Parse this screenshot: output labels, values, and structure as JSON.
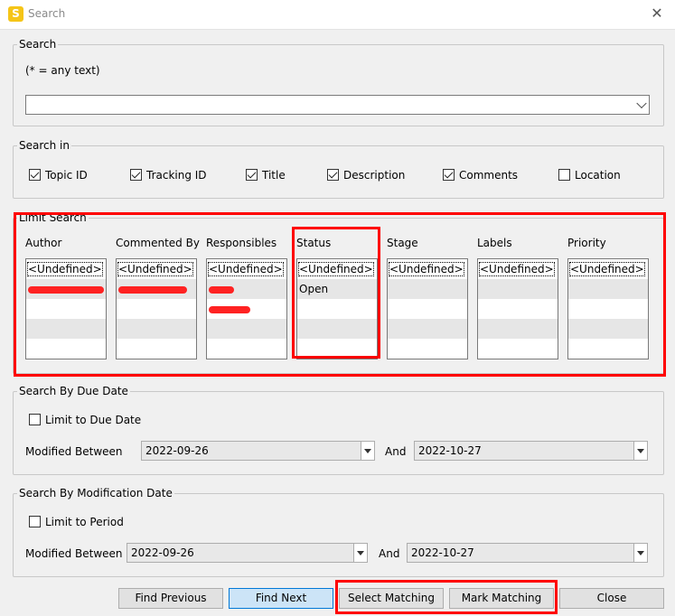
{
  "window": {
    "title": "Search",
    "icon_letter": "S"
  },
  "search": {
    "legend": "Search",
    "hint": "(* = any text)",
    "value": ""
  },
  "search_in": {
    "legend": "Search in",
    "options": [
      {
        "label": "Topic ID",
        "checked": true
      },
      {
        "label": "Tracking ID",
        "checked": true
      },
      {
        "label": "Title",
        "checked": true
      },
      {
        "label": "Description",
        "checked": true
      },
      {
        "label": "Comments",
        "checked": true
      },
      {
        "label": "Location",
        "checked": false
      }
    ]
  },
  "limit_search": {
    "legend": "Limit Search",
    "columns": [
      {
        "label": "Author",
        "items": [
          "<Undefined>"
        ]
      },
      {
        "label": "Commented By",
        "items": [
          "<Undefined>"
        ]
      },
      {
        "label": "Responsibles",
        "items": [
          "<Undefined>"
        ]
      },
      {
        "label": "Status",
        "items": [
          "<Undefined>",
          "Open"
        ]
      },
      {
        "label": "Stage",
        "items": [
          "<Undefined>"
        ]
      },
      {
        "label": "Labels",
        "items": [
          "<Undefined>"
        ]
      },
      {
        "label": "Priority",
        "items": [
          "<Undefined>"
        ]
      }
    ]
  },
  "due_date": {
    "legend": "Search By Due Date",
    "limit_label": "Limit to Due Date",
    "limit_checked": false,
    "between_label": "Modified Between",
    "from": "2022-09-26",
    "and_label": "And",
    "to": "2022-10-27"
  },
  "mod_date": {
    "legend": "Search By Modification Date",
    "limit_label": "Limit to Period",
    "limit_checked": false,
    "between_label": "Modified Between",
    "from": "2022-09-26",
    "and_label": "And",
    "to": "2022-10-27"
  },
  "buttons": {
    "find_previous": "Find Previous",
    "find_next": "Find Next",
    "select_matching": "Select Matching",
    "mark_matching": "Mark Matching",
    "close": "Close"
  },
  "colors": {
    "highlight": "#ff0000",
    "redaction": "#ff2222",
    "primary_button": "#cce4f7"
  }
}
